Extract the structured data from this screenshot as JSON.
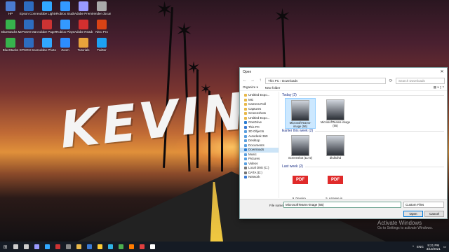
{
  "overlay_text": "KEVIN",
  "desktop_icons": [
    {
      "label": "HP",
      "color": "#4a7bd0"
    },
    {
      "label": "Epson Connect Sca...",
      "color": "#2d6cc0"
    },
    {
      "label": "Adobe Lightroo...",
      "color": "#31a8ff"
    },
    {
      "label": "Roblox Studio",
      "color": "#3399ff"
    },
    {
      "label": "Adobe Premiere...",
      "color": "#9999ff"
    },
    {
      "label": "render documents",
      "color": "#aaaaaa"
    },
    {
      "label": "BlueStacks Multi-Insta...",
      "color": "#37b24d"
    },
    {
      "label": "EPSON Manuals",
      "color": "#2d6cc0"
    },
    {
      "label": "Adobe PageMak...",
      "color": "#cc3333"
    },
    {
      "label": "Roblox Player",
      "color": "#3399ff"
    },
    {
      "label": "Adobe Reader X",
      "color": "#d32f2f"
    },
    {
      "label": "Nitro Pro",
      "color": "#d84315"
    },
    {
      "label": "BlueStacks",
      "color": "#37b24d"
    },
    {
      "label": "EPSON Scan",
      "color": "#2d6cc0"
    },
    {
      "label": "Adobe Photosh...",
      "color": "#31a8ff"
    },
    {
      "label": "Zoom",
      "color": "#2d8cff"
    },
    {
      "label": "Tutorials",
      "color": "#e8a33b"
    },
    {
      "label": "Twitter",
      "color": "#1da1f2"
    }
  ],
  "dialog": {
    "title": "Open",
    "path_root": "This PC",
    "path_folder": "Downloads",
    "search_placeholder": "Search Downloads",
    "toolbar": {
      "organize": "Organize ▾",
      "new_folder": "New folder"
    },
    "nav_items": [
      {
        "label": "Untitled Expo...",
        "color": "#e8b84a"
      },
      {
        "label": "MG",
        "color": "#e8b84a"
      },
      {
        "label": "Camera Roll",
        "color": "#e8b84a"
      },
      {
        "label": "Captures",
        "color": "#e8b84a"
      },
      {
        "label": "Screenshots",
        "color": "#e8b84a"
      },
      {
        "label": "Untitled Expo...",
        "color": "#e8b84a"
      },
      {
        "label": "OneDrive",
        "color": "#2b7cd3"
      },
      {
        "label": "This PC",
        "color": "#3a7bd5"
      },
      {
        "label": "3D Objects",
        "color": "#5aa0e0"
      },
      {
        "label": "Autodesk 360",
        "color": "#5aa0e0"
      },
      {
        "label": "Desktop",
        "color": "#5aa0e0"
      },
      {
        "label": "Documents",
        "color": "#5aa0e0"
      },
      {
        "label": "Downloads",
        "color": "#2b7cd3",
        "selected": true
      },
      {
        "label": "Music",
        "color": "#5aa0e0"
      },
      {
        "label": "Pictures",
        "color": "#5aa0e0"
      },
      {
        "label": "Videos",
        "color": "#5aa0e0"
      },
      {
        "label": "Local Disk (C:)",
        "color": "#777"
      },
      {
        "label": "DATA (D:)",
        "color": "#777"
      },
      {
        "label": "Network",
        "color": "#3a7bd5"
      }
    ],
    "groups": [
      {
        "title": "Today (2)",
        "files": [
          {
            "name": "MicrosoftTeams-image (56)",
            "type": "image",
            "selected": true
          },
          {
            "name": "MicrosoftTeams-image (55)",
            "type": "image"
          }
        ]
      },
      {
        "title": "Earlier this week (2)",
        "files": [
          {
            "name": "Screenshot (1172)",
            "type": "image"
          },
          {
            "name": "dhdhdhd",
            "type": "image"
          }
        ]
      },
      {
        "title": "Last week (2)",
        "files": [
          {
            "name": "9. Devoira...",
            "type": "pdf"
          },
          {
            "name": "5. Arrange in...",
            "type": "pdf"
          }
        ]
      }
    ],
    "file_name_label": "File name:",
    "file_name_value": "MicrosoftTeams-image (56)",
    "filter": "Custom Files",
    "open_label": "Open",
    "cancel_label": "Cancel"
  },
  "activate": {
    "line1": "Activate Windows",
    "line2": "Go to Settings to activate Windows."
  },
  "taskbar": {
    "start_icon": "windows-logo-icon",
    "apps": [
      {
        "name": "search-icon",
        "color": "#cccccc"
      },
      {
        "name": "task-view-icon",
        "color": "#cccccc"
      },
      {
        "name": "premiere-icon",
        "color": "#9999ff"
      },
      {
        "name": "photoshop-icon",
        "color": "#31a8ff"
      },
      {
        "name": "app-icon",
        "color": "#cc3333"
      },
      {
        "name": "app-icon",
        "color": "#888888"
      },
      {
        "name": "file-explorer-icon",
        "color": "#e8b84a"
      },
      {
        "name": "app-icon",
        "color": "#3a7bd5"
      },
      {
        "name": "app-icon",
        "color": "#ffcc33"
      },
      {
        "name": "edge-icon",
        "color": "#2fb3e6"
      },
      {
        "name": "app-icon",
        "color": "#4caf50"
      },
      {
        "name": "firefox-icon",
        "color": "#ff7b00"
      },
      {
        "name": "app-icon",
        "color": "#e04040"
      },
      {
        "name": "app-icon",
        "color": "#ffffff"
      }
    ],
    "time": "9:21 PM",
    "date": "3/10/2021",
    "lang": "ENG"
  }
}
